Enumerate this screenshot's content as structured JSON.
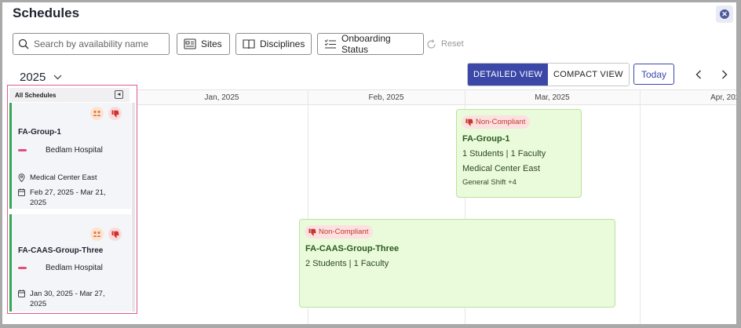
{
  "header": {
    "title": "Schedules"
  },
  "filters": {
    "search_placeholder": "Search by availability name",
    "sites_label": "Sites",
    "disciplines_label": "Disciplines",
    "onboarding_label": "Onboarding Status",
    "reset_label": "Reset"
  },
  "year": "2025",
  "views": {
    "detailed": "DETAILED VIEW",
    "compact": "COMPACT VIEW",
    "active": "detailed"
  },
  "today_label": "Today",
  "months": [
    "Jan, 2025",
    "Feb, 2025",
    "Mar, 2025",
    "Apr, 2025"
  ],
  "sidebar": {
    "header": "All Schedules",
    "items": [
      {
        "name": "FA-Group-1",
        "site": "Bedlam Hospital",
        "location": "Medical Center East",
        "dates": "Feb 27, 2025 - Mar 21, 2025"
      },
      {
        "name": "FA-CAAS-Group-Three",
        "site": "Bedlam Hospital",
        "dates": "Jan 30, 2025 - Mar 27, 2025"
      }
    ]
  },
  "events": [
    {
      "status": "Non-Compliant",
      "name": "FA-Group-1",
      "people": "1 Students | 1 Faculty",
      "location": "Medical Center East",
      "shift": "General Shift +4"
    },
    {
      "status": "Non-Compliant",
      "name": "FA-CAAS-Group-Three",
      "people": "2 Students | 1 Faculty"
    }
  ],
  "colors": {
    "primary": "#3b48a8",
    "event_bg": "#eafbdb",
    "event_border": "#b8e39b",
    "noncompliant_text": "#c0392b",
    "noncompliant_bg": "#fde0e0",
    "sidebar_accent": "#34a853",
    "highlight_border": "#e05a94"
  },
  "icons": [
    "close-icon",
    "search-icon",
    "sites-icon",
    "disciplines-icon",
    "onboarding-icon",
    "reset-icon",
    "chevron-down-icon",
    "chevron-left-icon",
    "chevron-right-icon",
    "collapse-icon",
    "warning-people-icon",
    "thumbs-down-icon",
    "location-pin-icon",
    "calendar-icon"
  ]
}
